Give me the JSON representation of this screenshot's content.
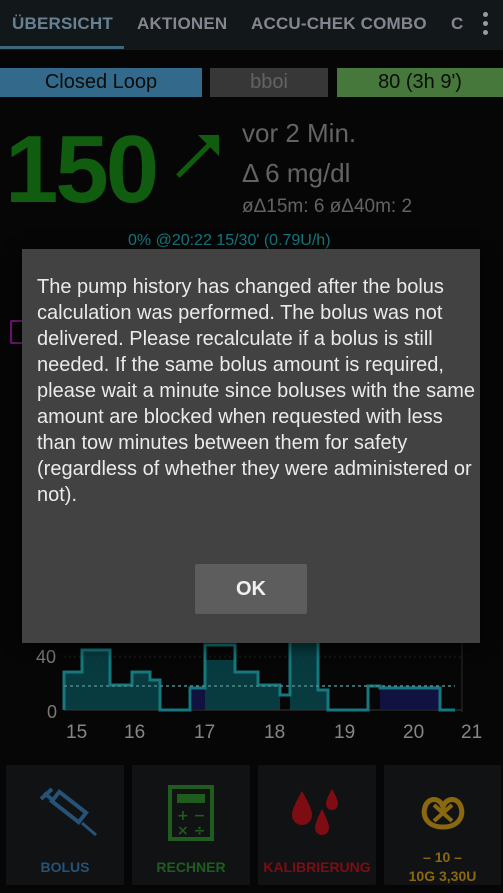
{
  "tabs": [
    "ÜBERSICHT",
    "AKTIONEN",
    "ACCU-CHEK COMBO",
    "C"
  ],
  "status": {
    "loop": "Closed Loop",
    "profile": "bboi",
    "target": "80 (3h 9')"
  },
  "bg": {
    "value": "150",
    "time_ago": "vor 2 Min.",
    "delta": "Δ 6 mg/dl",
    "avg_deltas": "øΔ15m: 6  øΔ40m: 2",
    "temp_basal": "0% @20:22 15/30' (0.79U/h)"
  },
  "chart": {
    "y_ticks": [
      "40",
      "0"
    ],
    "x_ticks": [
      "15",
      "16",
      "17",
      "18",
      "19",
      "20",
      "21"
    ]
  },
  "dialog": {
    "message": "The pump history has changed after the bolus calculation was performed. The bolus was not delivered. Please recalculate if a bolus is still needed. If the same bolus amount is required, please wait a minute since boluses with the same amount are blocked when requested with less than tow minutes between them for safety (regardless of whether they were administered or not).",
    "ok_label": "OK"
  },
  "buttons": {
    "bolus": "BOLUS",
    "rechner": "RECHNER",
    "kalibrierung": "KALIBRIERUNG",
    "carbs_line1": "– 10 –",
    "carbs_line2": "10G 3,30U"
  },
  "colors": {
    "loop_bg": "#4fa3d6",
    "profile_bg": "#555555",
    "target_bg": "#6ab85a",
    "bg_value": "#1a8f1a",
    "basal": "#1fb8c2",
    "bolus_label": "#3a7fb5",
    "rechner_label": "#2f8f2f",
    "kalibrierung_label": "#c0141e",
    "carbs_label": "#d5a017"
  }
}
